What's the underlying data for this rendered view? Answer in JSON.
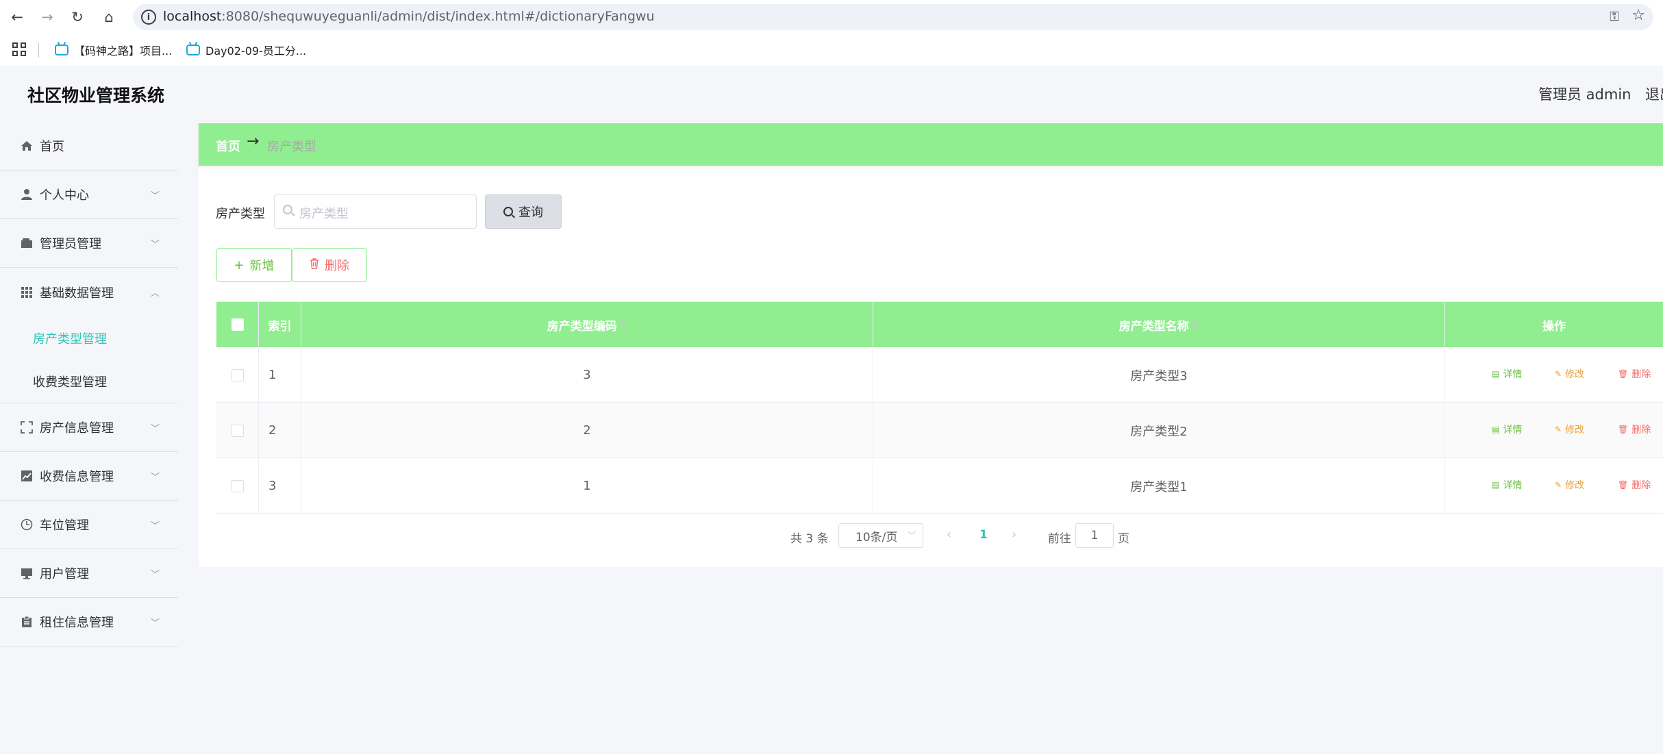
{
  "browser": {
    "url_host": "localhost",
    "url_path": ":8080/shequwuyeguanli/admin/dist/index.html#/dictionaryFangwu",
    "bookmarks": [
      {
        "label": "【码神之路】项目..."
      },
      {
        "label": "Day02-09-员工分..."
      }
    ]
  },
  "header": {
    "title": "社区物业管理系统",
    "user": "管理员 admin",
    "logout": "退出"
  },
  "sidebar": {
    "items": [
      {
        "label": "首页",
        "icon": "home-icon"
      },
      {
        "label": "个人中心",
        "icon": "user-icon"
      },
      {
        "label": "管理员管理",
        "icon": "wallet-icon"
      },
      {
        "label": "基础数据管理",
        "icon": "grid-icon"
      },
      {
        "label": "房产信息管理",
        "icon": "fullscreen-icon"
      },
      {
        "label": "收费信息管理",
        "icon": "chart-icon"
      },
      {
        "label": "车位管理",
        "icon": "clock-icon"
      },
      {
        "label": "用户管理",
        "icon": "monitor-icon"
      },
      {
        "label": "租住信息管理",
        "icon": "clipboard-icon"
      }
    ],
    "sub_items": [
      {
        "label": "房产类型管理",
        "active": true
      },
      {
        "label": "收费类型管理",
        "active": false
      }
    ]
  },
  "breadcrumb": {
    "home": "首页",
    "current": "房产类型"
  },
  "search": {
    "label": "房产类型",
    "placeholder": "房产类型",
    "button": "查询"
  },
  "actions": {
    "add": "新增",
    "delete": "删除"
  },
  "table": {
    "headers": {
      "index": "索引",
      "code": "房产类型编码",
      "name": "房产类型名称",
      "ops": "操作"
    },
    "rows": [
      {
        "index": "1",
        "code": "3",
        "name": "房产类型3"
      },
      {
        "index": "2",
        "code": "2",
        "name": "房产类型2"
      },
      {
        "index": "3",
        "code": "1",
        "name": "房产类型1"
      }
    ],
    "row_actions": {
      "detail": "详情",
      "edit": "修改",
      "remove": "删除"
    }
  },
  "pagination": {
    "total": "共 3 条",
    "page_size": "10条/页",
    "current_page": "1",
    "goto_prefix": "前往",
    "goto_value": "1",
    "goto_suffix": "页"
  },
  "colors": {
    "accent_green": "#90ee90",
    "active_teal": "#2ec5b6"
  }
}
